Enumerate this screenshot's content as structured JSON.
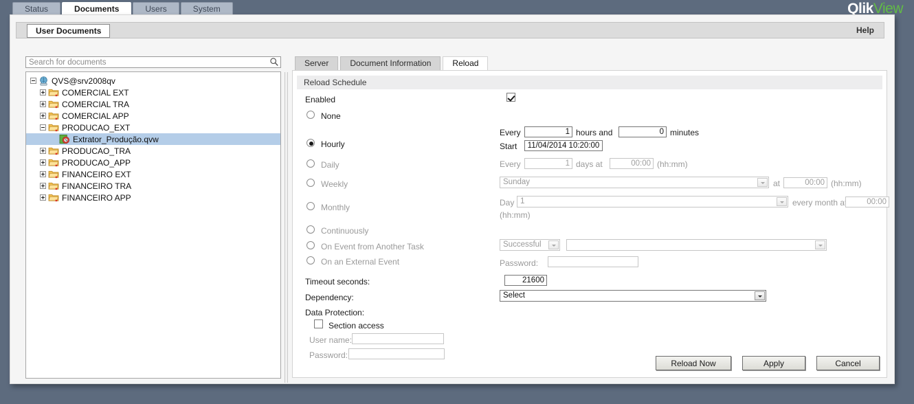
{
  "brand": {
    "part1": "Qlik",
    "part2": "View",
    "green": "#62bb46"
  },
  "top_tabs": [
    {
      "label": "Status",
      "active": false
    },
    {
      "label": "Documents",
      "active": true
    },
    {
      "label": "Users",
      "active": false
    },
    {
      "label": "System",
      "active": false
    }
  ],
  "subbar": {
    "tab_label": "User Documents",
    "help_label": "Help"
  },
  "search": {
    "placeholder": "Search for documents",
    "value": ""
  },
  "tree": {
    "root": {
      "label": "QVS@srv2008qv",
      "expanded": true
    },
    "nodes": [
      {
        "label": "COMERCIAL EXT",
        "expanded": false,
        "type": "folder"
      },
      {
        "label": "COMERCIAL TRA",
        "expanded": false,
        "type": "folder"
      },
      {
        "label": "COMERCIAL APP",
        "expanded": false,
        "type": "folder"
      },
      {
        "label": "PRODUCAO_EXT",
        "expanded": true,
        "type": "folder"
      },
      {
        "label": "Extrator_Produção.qvw",
        "type": "document",
        "selected": true
      },
      {
        "label": "PRODUCAO_TRA",
        "expanded": false,
        "type": "folder"
      },
      {
        "label": "PRODUCAO_APP",
        "expanded": false,
        "type": "folder"
      },
      {
        "label": "FINANCEIRO EXT",
        "expanded": false,
        "type": "folder"
      },
      {
        "label": "FINANCEIRO TRA",
        "expanded": false,
        "type": "folder"
      },
      {
        "label": "FINANCEIRO APP",
        "expanded": false,
        "type": "folder"
      }
    ]
  },
  "content_tabs": [
    {
      "label": "Server",
      "active": false
    },
    {
      "label": "Document Information",
      "active": false
    },
    {
      "label": "Reload",
      "active": true
    }
  ],
  "reload": {
    "section_title": "Reload Schedule",
    "enabled_label": "Enabled",
    "enabled_checked": true,
    "options": {
      "none": "None",
      "hourly": "Hourly",
      "daily": "Daily",
      "weekly": "Weekly",
      "monthly": "Monthly",
      "continuously": "Continuously",
      "on_event": "On Event from Another Task",
      "on_external": "On an External Event"
    },
    "selected_option": "hourly",
    "hourly": {
      "every_label": "Every",
      "hours_value": "1",
      "hours_label": "hours and",
      "minutes_value": "0",
      "minutes_label": "minutes",
      "start_label": "Start",
      "start_value": "11/04/2014 10:20:00"
    },
    "daily": {
      "every_label": "Every",
      "days_value": "1",
      "days_label": "days at",
      "time_value": "00:00",
      "format_label": "(hh:mm)"
    },
    "weekly": {
      "day_value": "Sunday",
      "at_label": "at",
      "time_value": "00:00",
      "format_label": "(hh:mm)"
    },
    "monthly": {
      "day_label": "Day",
      "day_value": "1",
      "every_month_label": "every month at",
      "time_value": "00:00",
      "format_label": "(hh:mm)"
    },
    "on_event": {
      "status_value": "Successful",
      "task_value": ""
    },
    "on_external": {
      "password_label": "Password:",
      "password_value": ""
    },
    "timeout": {
      "label": "Timeout seconds:",
      "value": "21600"
    },
    "dependency": {
      "label": "Dependency:",
      "value": "Select"
    },
    "data_protection": {
      "label": "Data Protection:",
      "section_access_label": "Section access",
      "section_access_checked": false,
      "username_label": "User name:",
      "username_value": "",
      "password_label": "Password:",
      "password_value": ""
    }
  },
  "buttons": {
    "reload_now": "Reload Now",
    "apply": "Apply",
    "cancel": "Cancel"
  }
}
